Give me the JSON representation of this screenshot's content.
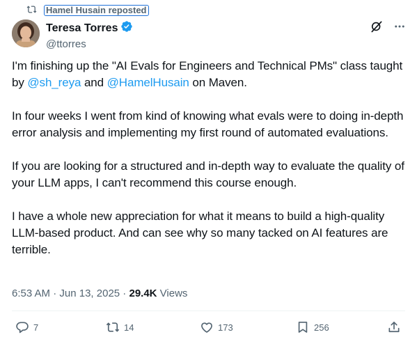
{
  "repost": {
    "icon": "repost-icon",
    "label": "Hamel Husain reposted"
  },
  "author": {
    "display_name": "Teresa Torres",
    "handle": "@ttorres",
    "verified_icon": "verified-badge-icon",
    "avatar_icon": "avatar"
  },
  "header_actions": {
    "grok_icon": "grok-icon",
    "more_icon": "more-icon"
  },
  "tweet": {
    "p1_text_a": "I'm finishing up the \"AI Evals for Engineers and Technical PMs\" class taught by ",
    "p1_mention_1": "@sh_reya",
    "p1_text_b": " and ",
    "p1_mention_2": "@HamelHusain",
    "p1_text_c": " on Maven.",
    "p2": "In four weeks I went from kind of knowing what evals were to doing in-depth error analysis and implementing my first round of automated evaluations.",
    "p3": "If you are looking for a structured and in-depth way to evaluate the quality of your LLM apps, I can't recommend this course enough.",
    "p4": "I have a whole new appreciation for what it means to build a high-quality LLM-based product. And can see why so many tacked on AI features are terrible."
  },
  "meta": {
    "time": "6:53 AM",
    "sep1": " · ",
    "date": "Jun 13, 2025",
    "sep2": " · ",
    "views_count": "29.4K",
    "views_label": " Views"
  },
  "actions": {
    "replies": "7",
    "reposts": "14",
    "likes": "173",
    "bookmarks": "256",
    "icons": [
      "reply-icon",
      "repost-icon",
      "like-icon",
      "bookmark-icon",
      "share-icon"
    ]
  },
  "colors": {
    "link": "#1d9bf0",
    "muted": "#536471",
    "text": "#0f1419",
    "verified": "#1d9bf0"
  }
}
